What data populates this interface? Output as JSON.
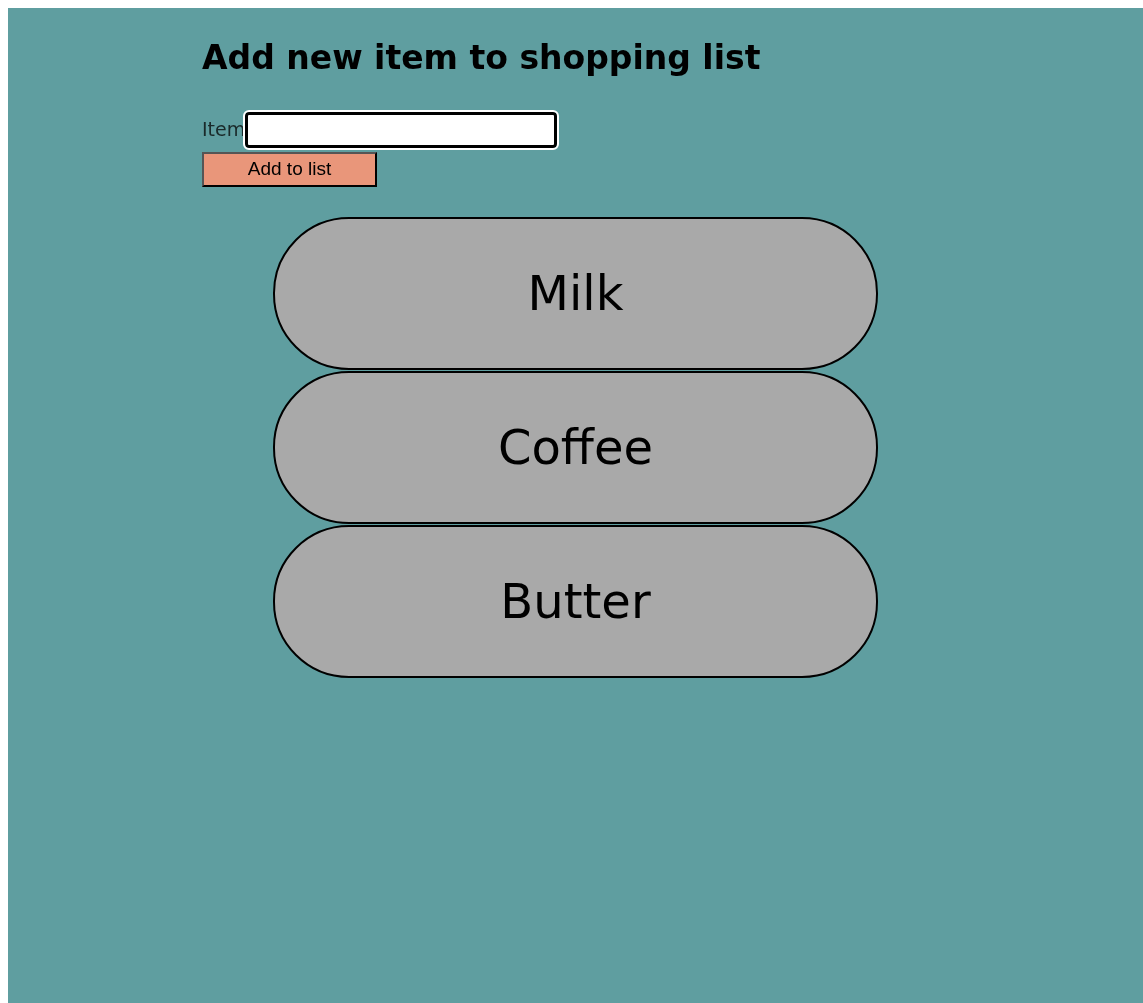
{
  "heading": "Add new item to shopping list",
  "form": {
    "label": "Item",
    "focused": true,
    "button": "Add to list"
  },
  "items": [
    {
      "name": "Milk"
    },
    {
      "name": "Coffee"
    },
    {
      "name": "Butter"
    }
  ]
}
